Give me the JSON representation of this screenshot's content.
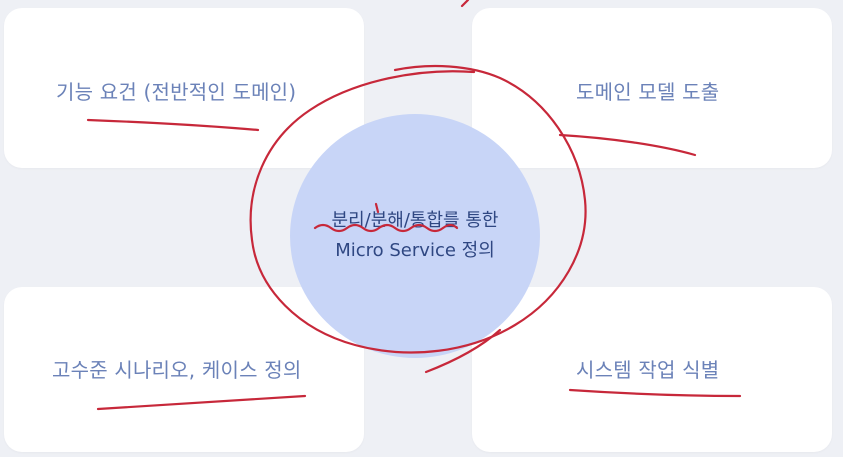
{
  "diagram": {
    "boxes": {
      "top_left": "기능 요건 (전반적인 도메인)",
      "top_right": "도메인 모델 도출",
      "bottom_left": "고수준 시나리오, 케이스 정의",
      "bottom_right": "시스템 작업 식별"
    },
    "center": {
      "line1": "분리/분해/통합를 통한",
      "line2": "Micro Service 정의"
    }
  },
  "colors": {
    "background": "#eef0f5",
    "card": "#ffffff",
    "label_text": "#6b82b8",
    "center_fill": "#c8d5f7",
    "center_text": "#2f4782",
    "annotation_pen": "#c7283a"
  }
}
